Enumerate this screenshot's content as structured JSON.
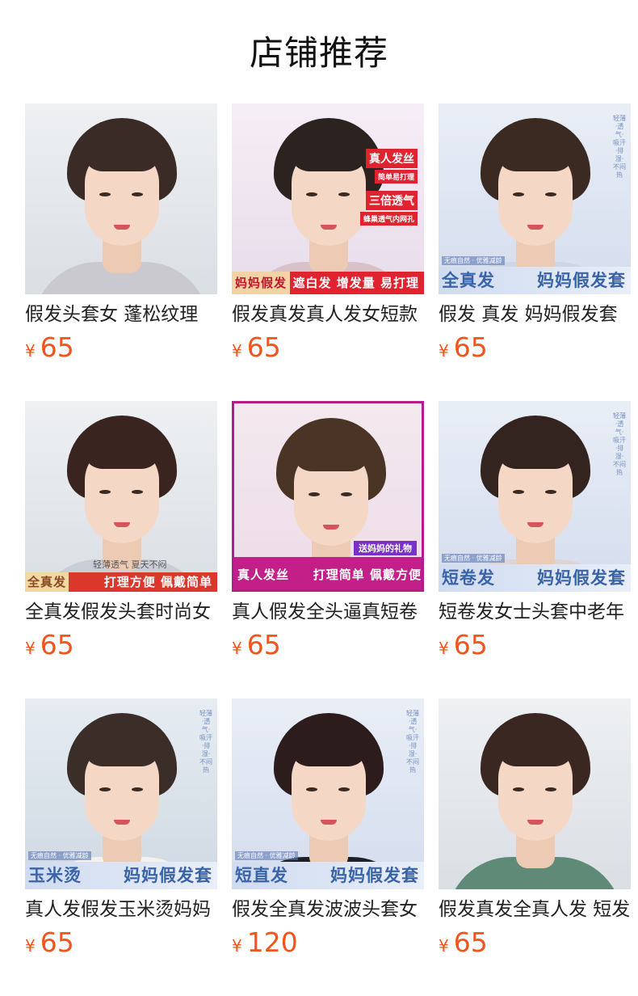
{
  "header": {
    "title": "店铺推荐"
  },
  "currency_symbol": "¥",
  "products": [
    {
      "name": "假发头套女 蓬松纹理",
      "price": "65",
      "image": {
        "theme": "gray",
        "banner_left": "",
        "banner_right": "",
        "extra": []
      }
    },
    {
      "name": "假发真发真人发女短款",
      "price": "65",
      "image": {
        "theme": "pink",
        "banner_left": "妈妈假发",
        "banner_right": "遮白发 增发量 易打理",
        "extra": [
          "真人发丝",
          "简单易打理",
          "三倍透气",
          "蜂巢透气内网孔"
        ]
      }
    },
    {
      "name": "假发 真发 妈妈假发套",
      "price": "65",
      "image": {
        "theme": "blue",
        "banner_left": "全真发",
        "banner_right": "妈妈假发套",
        "extra": [
          "无痕自然 · 优雅减龄"
        ],
        "side": "轻薄·透气·吸汗·排湿·不闷热"
      }
    },
    {
      "name": "全真发假发头套时尚女",
      "price": "65",
      "image": {
        "theme": "gray",
        "banner_left": "全真发",
        "banner_right": "打理方便 佩戴简单",
        "extra": [
          "轻薄透气  夏天不闷"
        ]
      }
    },
    {
      "name": "真人假发全头逼真短卷",
      "price": "65",
      "image": {
        "theme": "magenta",
        "banner_left": "真人发丝",
        "banner_right": "打理简单 佩戴方便",
        "extra": [
          "送妈妈的礼物"
        ]
      }
    },
    {
      "name": "短卷发女士头套中老年",
      "price": "65",
      "image": {
        "theme": "blue",
        "banner_left": "短卷发",
        "banner_right": "妈妈假发套",
        "extra": [
          "无痕自然 · 优雅减龄"
        ],
        "side": "轻薄·透气·吸汗·排湿·不闷热"
      }
    },
    {
      "name": "真人发假发玉米烫妈妈",
      "price": "65",
      "image": {
        "theme": "leaf",
        "banner_left": "玉米烫",
        "banner_right": "妈妈假发套",
        "extra": [
          "无痕自然 · 优雅减龄"
        ],
        "side": "轻薄·透气·吸汗·排湿·不闷热"
      }
    },
    {
      "name": "假发全真发波波头套女",
      "price": "120",
      "image": {
        "theme": "blue",
        "banner_left": "短直发",
        "banner_right": "妈妈假发套",
        "extra": [
          "无痕自然 · 优雅减龄"
        ],
        "side": "轻薄·透气·吸汗·排湿·不闷热"
      }
    },
    {
      "name": "假发真发全真人发 短发",
      "price": "65",
      "image": {
        "theme": "gray",
        "banner_left": "",
        "banner_right": "",
        "extra": []
      }
    }
  ],
  "colors": {
    "price": "#f2541b",
    "title": "#111111",
    "accent_blue": "#3b63a8",
    "accent_red": "#e0242f"
  }
}
